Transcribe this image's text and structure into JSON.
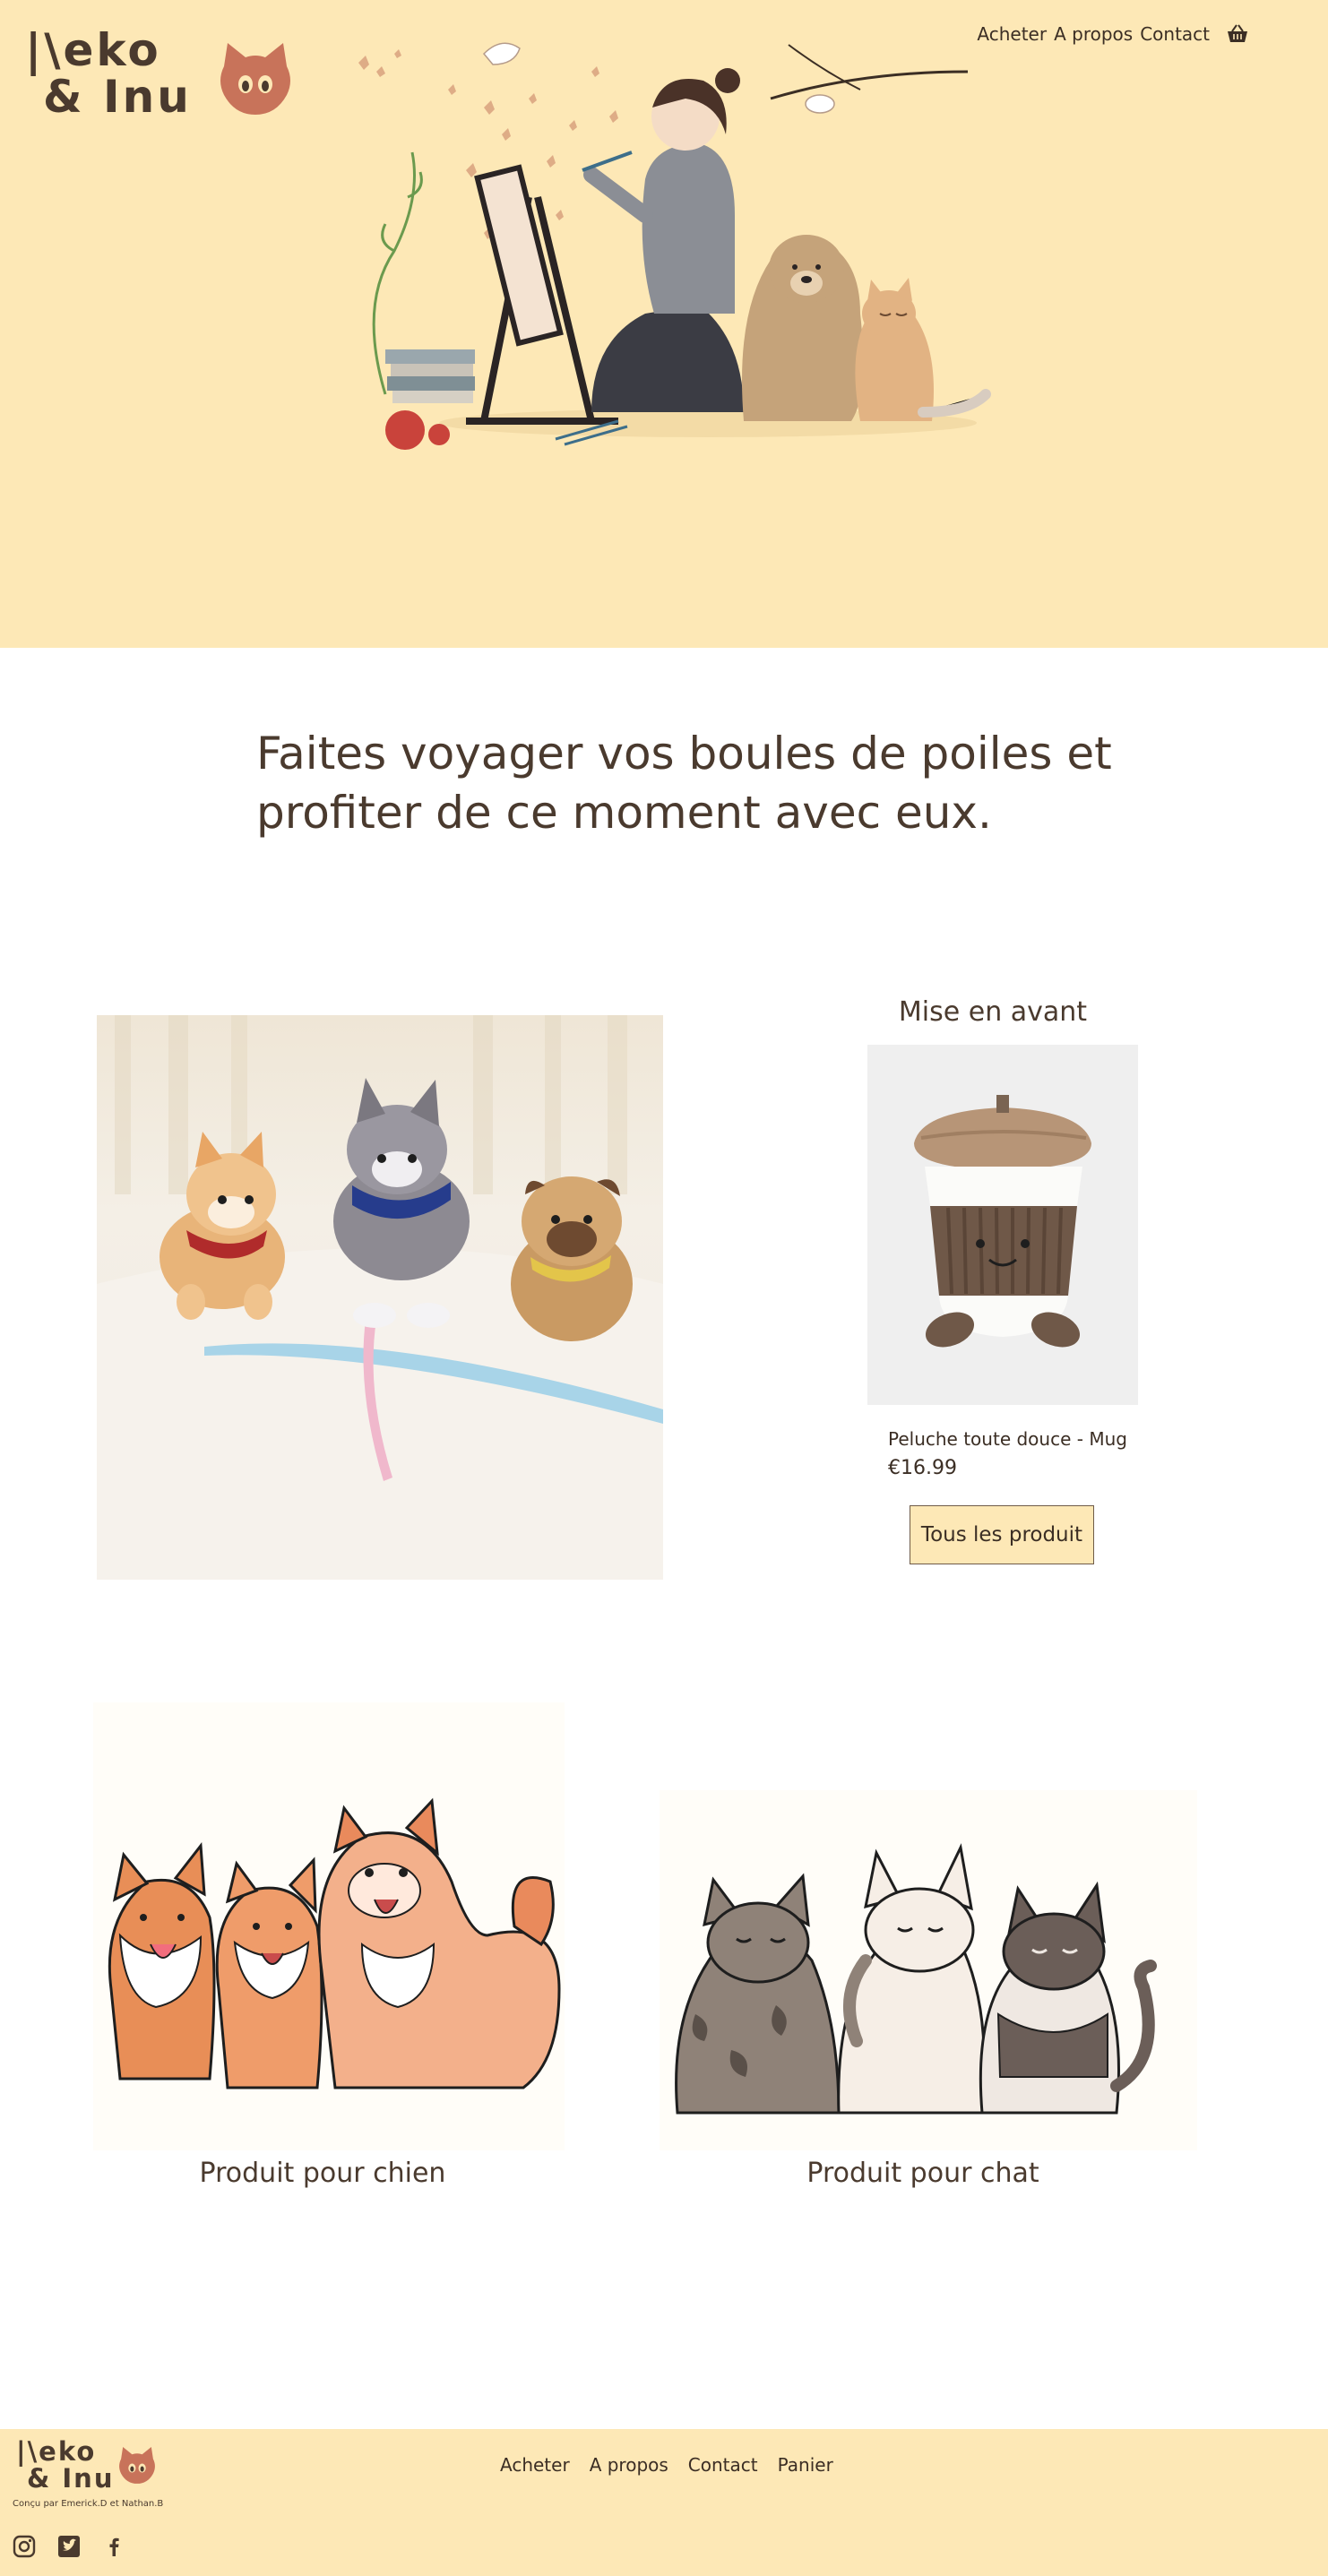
{
  "header": {
    "logo_line1": "|\\eko",
    "logo_line2": "& Inu",
    "nav": [
      "Acheter",
      "A propos",
      "Contact"
    ],
    "basket_icon": "basket-icon"
  },
  "hero": {
    "illustration": "girl-painting-with-dog-and-cat"
  },
  "tagline": "Faites voyager vos boules de poiles et profiter de ce moment avec eux.",
  "featured": {
    "title": "Mise en avant",
    "product_name": "Peluche toute douce - Mug",
    "product_price": "€16.99",
    "button_label": "Tous les produit"
  },
  "categories": [
    {
      "label": "Produit pour chien"
    },
    {
      "label": "Produit pour chat"
    }
  ],
  "footer": {
    "logo_line1": "|\\eko",
    "logo_line2": "& Inu",
    "credit": "Conçu par Emerick.D et Nathan.B",
    "nav": [
      "Acheter",
      "A propos",
      "Contact",
      "Panier"
    ],
    "social": [
      "instagram-icon",
      "twitter-icon",
      "facebook-icon"
    ]
  },
  "colors": {
    "cream": "#fde8b6",
    "brown_text": "#4a3a2e",
    "cat_orange": "#c8735a"
  }
}
